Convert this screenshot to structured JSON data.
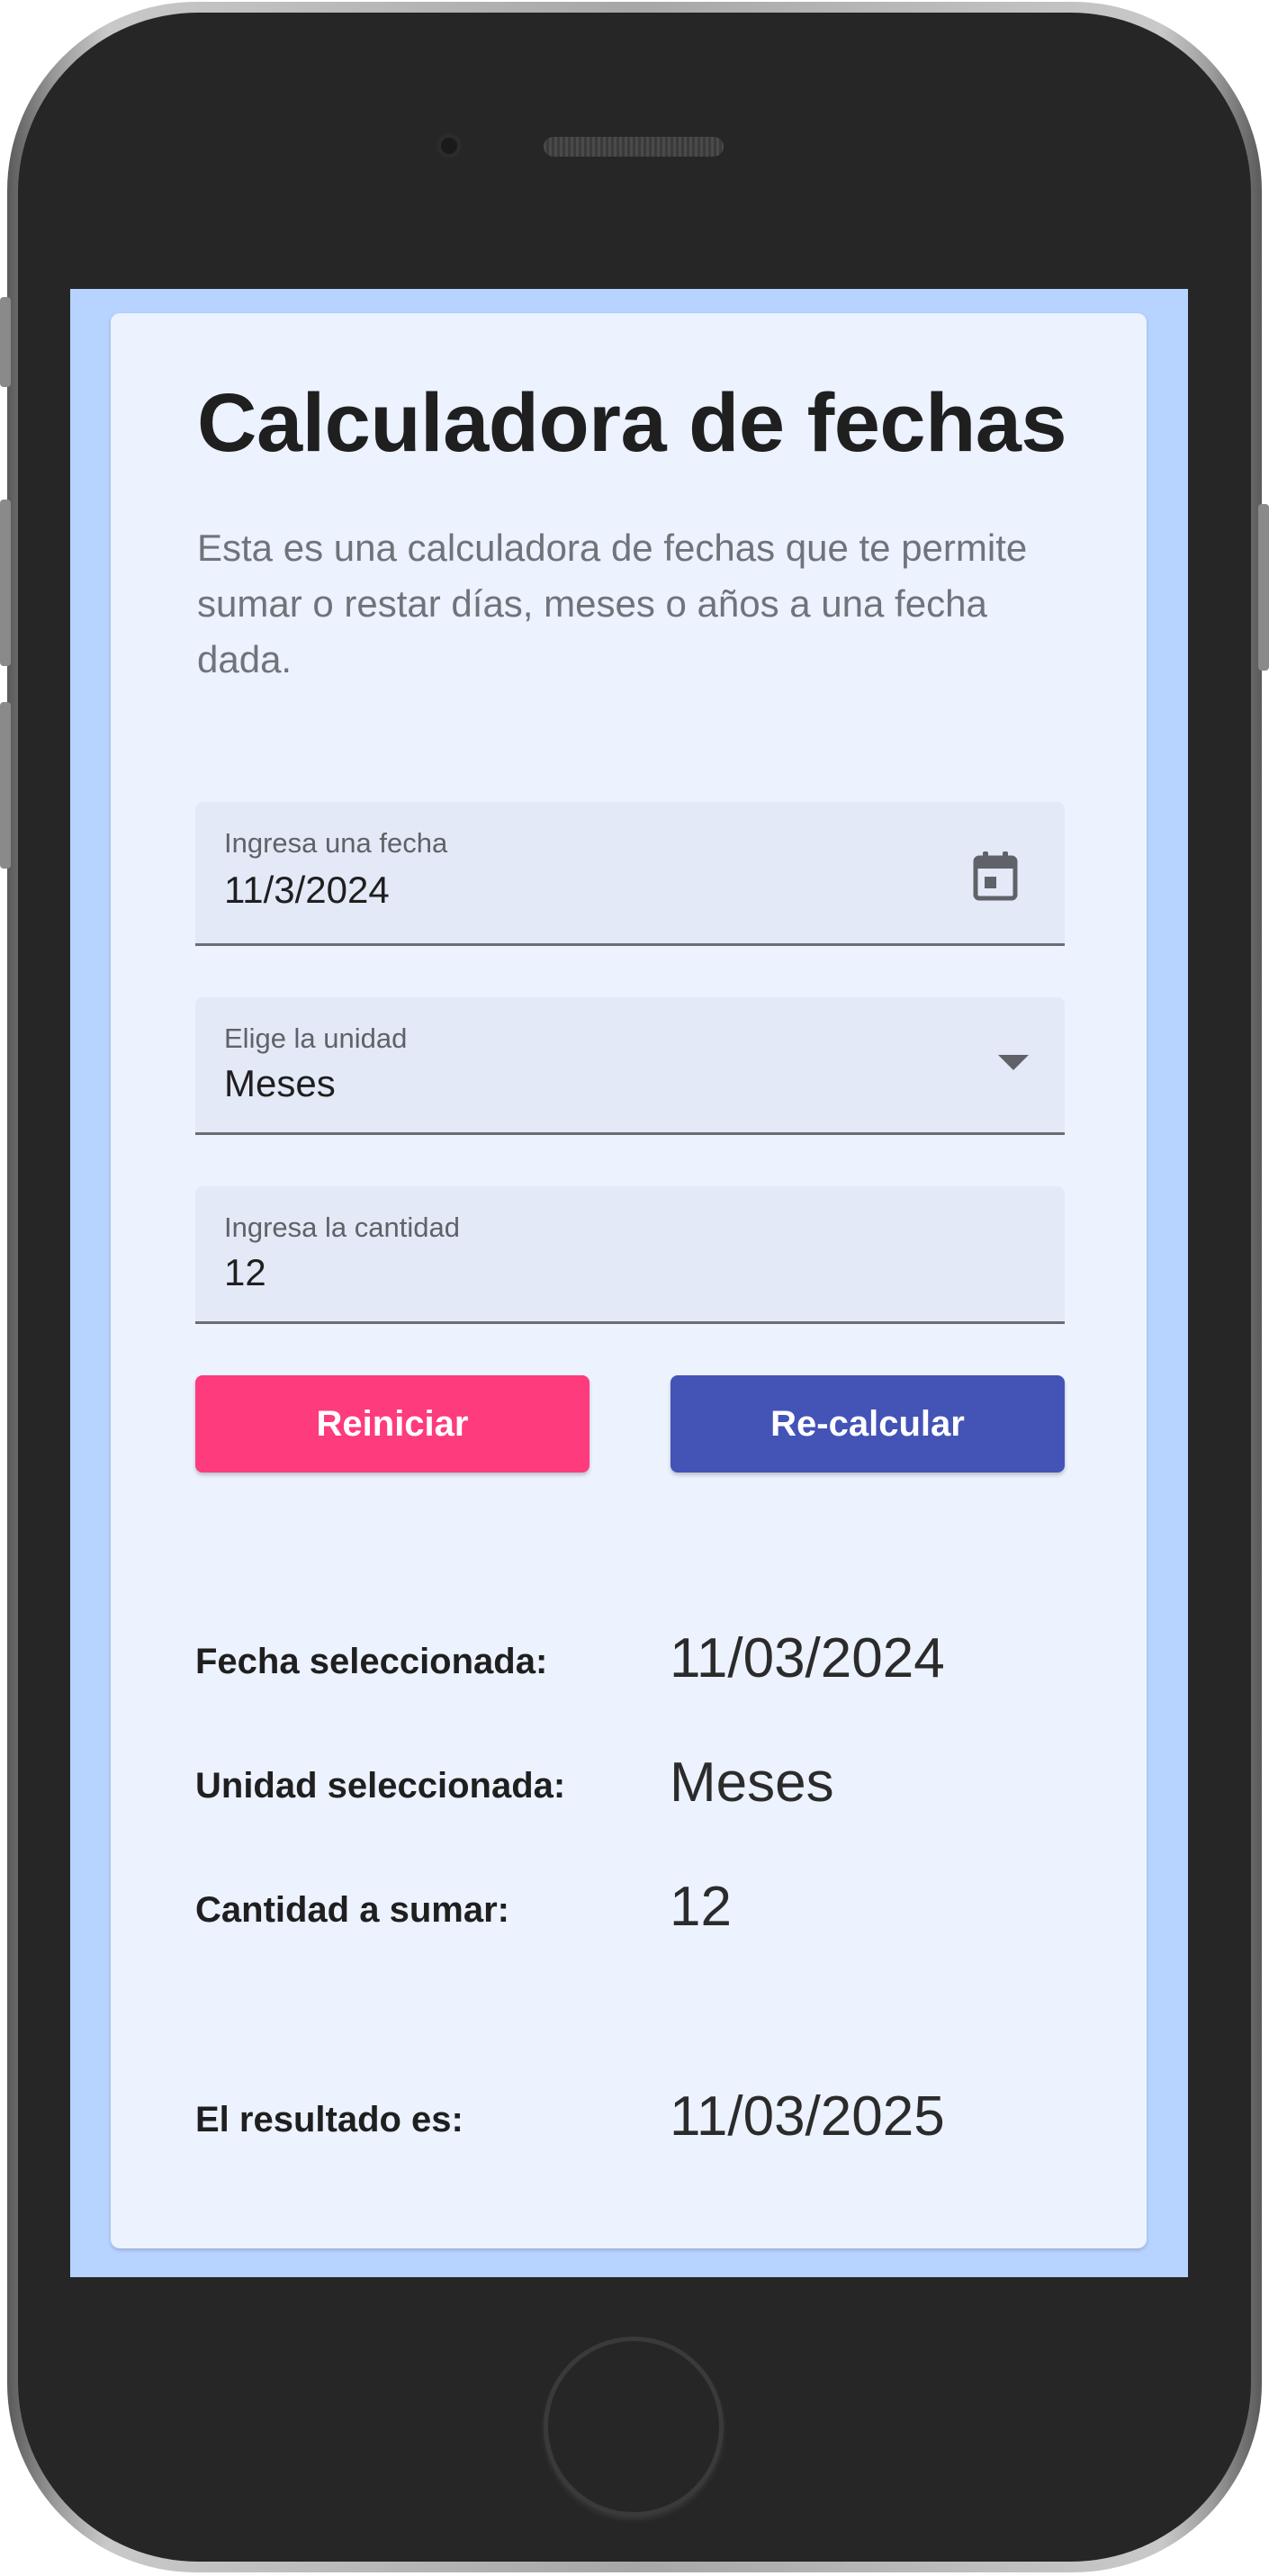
{
  "app": {
    "title": "Calculadora de fechas",
    "description": "Esta es una calculadora de fechas que te permite sumar o restar días, meses o años a una fecha dada."
  },
  "form": {
    "date_field": {
      "label": "Ingresa una fecha",
      "value": "11/3/2024",
      "icon": "calendar-icon"
    },
    "unit_field": {
      "label": "Elige la unidad",
      "value": "Meses",
      "icon": "dropdown-arrow-icon"
    },
    "quantity_field": {
      "label": "Ingresa la cantidad",
      "value": "12"
    }
  },
  "buttons": {
    "reset_label": "Reiniciar",
    "recalc_label": "Re-calcular"
  },
  "summary": {
    "selected_date_label": "Fecha seleccionada:",
    "selected_date_value": "11/03/2024",
    "selected_unit_label": "Unidad seleccionada:",
    "selected_unit_value": "Meses",
    "quantity_label": "Cantidad a sumar:",
    "quantity_value": "12",
    "result_label": "El resultado es:",
    "result_value": "11/03/2025"
  },
  "colors": {
    "screen_background": "#b7d3ff",
    "card_background": "#ecf2fe",
    "reset_button": "#fd3b7d",
    "recalc_button": "#4353b6"
  }
}
